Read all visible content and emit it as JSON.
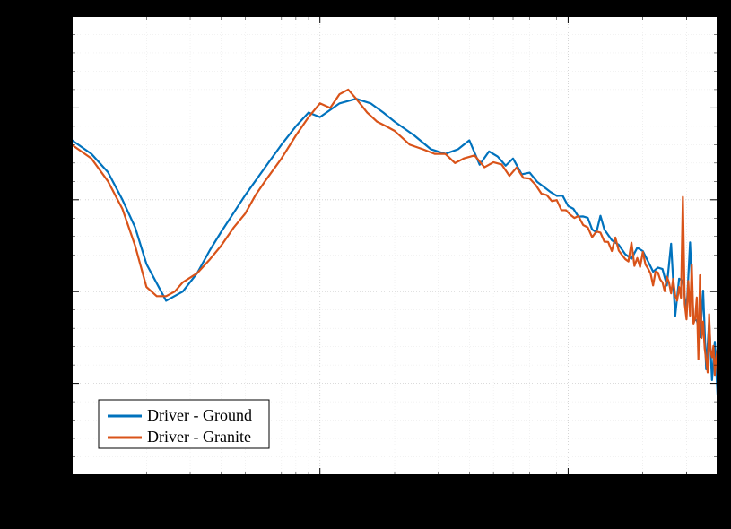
{
  "chart_data": {
    "type": "line",
    "xscale": "log",
    "xlim": [
      10,
      4000
    ],
    "ylim": [
      -20,
      30
    ],
    "x_ticks": [
      10,
      100,
      1000
    ],
    "y_ticks": [
      -20,
      -10,
      0,
      10,
      20,
      30
    ],
    "legend_position": "bottom-left",
    "series": [
      {
        "name": "Driver - Ground",
        "color": "#0072BD",
        "x": [
          10,
          12,
          14,
          16,
          18,
          20,
          24,
          28,
          32,
          36,
          40,
          50,
          60,
          70,
          80,
          90,
          100,
          120,
          140,
          160,
          180,
          200,
          240,
          280,
          320,
          360,
          400,
          440,
          480,
          520,
          560,
          600,
          650,
          700,
          750,
          800,
          850,
          900,
          950,
          1000,
          1050,
          1100,
          1150,
          1200,
          1250,
          1300,
          1350,
          1400,
          1500,
          1600,
          1700,
          1800,
          1900,
          2000,
          2100,
          2200,
          2300,
          2400,
          2500,
          2600,
          2700,
          2800,
          2900,
          3000,
          3100,
          3200,
          3300,
          3400,
          3500,
          3600,
          3700,
          3800,
          3900,
          4000
        ],
        "y": [
          16.5,
          15.0,
          13.0,
          10.0,
          7.0,
          3.0,
          -1.0,
          0.0,
          2.0,
          4.5,
          6.5,
          10.5,
          13.5,
          16.0,
          18.0,
          19.5,
          19.0,
          20.5,
          21.0,
          20.5,
          19.5,
          18.5,
          17.0,
          15.5,
          15.0,
          15.5,
          16.5,
          14.0,
          15.0,
          14.5,
          14.0,
          14.5,
          13.0,
          12.5,
          12.0,
          11.5,
          11.0,
          10.5,
          10.0,
          9.5,
          9.0,
          8.5,
          8.0,
          7.5,
          7.0,
          6.5,
          9.0,
          6.0,
          5.5,
          5.0,
          4.5,
          4.0,
          4.0,
          4.5,
          3.0,
          3.0,
          2.5,
          2.0,
          0.5,
          5.0,
          -1.0,
          0.5,
          1.0,
          -3.0,
          6.0,
          -2.0,
          -4.0,
          -5.0,
          -1.0,
          -7.0,
          -3.0,
          -10.0,
          -6.0,
          -12.0
        ]
      },
      {
        "name": "Driver - Granite",
        "color": "#D95319",
        "x": [
          10,
          12,
          14,
          16,
          18,
          20,
          22,
          24,
          26,
          28,
          32,
          36,
          40,
          45,
          50,
          55,
          60,
          70,
          80,
          90,
          100,
          110,
          120,
          130,
          140,
          155,
          170,
          185,
          200,
          230,
          260,
          290,
          320,
          350,
          380,
          420,
          460,
          500,
          540,
          580,
          620,
          660,
          700,
          740,
          780,
          820,
          860,
          900,
          940,
          980,
          1020,
          1060,
          1100,
          1150,
          1200,
          1250,
          1300,
          1350,
          1400,
          1450,
          1500,
          1550,
          1600,
          1650,
          1700,
          1750,
          1800,
          1850,
          1900,
          1950,
          2000,
          2050,
          2100,
          2150,
          2200,
          2250,
          2300,
          2350,
          2400,
          2450,
          2500,
          2550,
          2600,
          2650,
          2700,
          2750,
          2800,
          2850,
          2900,
          2950,
          3000,
          3050,
          3100,
          3150,
          3200,
          3250,
          3300,
          3350,
          3400,
          3450,
          3500,
          3550,
          3600,
          3650,
          3700,
          3750,
          3800,
          3850,
          3900,
          3950,
          4000
        ],
        "y": [
          16.0,
          14.5,
          12.0,
          9.0,
          5.0,
          0.5,
          -0.5,
          -0.5,
          0.0,
          1.0,
          2.0,
          3.5,
          5.0,
          7.0,
          8.5,
          10.5,
          12.0,
          14.5,
          17.0,
          19.0,
          20.5,
          20.0,
          21.5,
          22.0,
          21.0,
          19.5,
          18.5,
          18.0,
          17.5,
          16.0,
          15.5,
          15.0,
          15.0,
          14.0,
          14.5,
          15.0,
          13.5,
          14.0,
          13.5,
          13.0,
          13.5,
          12.5,
          12.0,
          11.5,
          11.0,
          10.5,
          10.0,
          9.5,
          9.0,
          9.0,
          8.5,
          8.0,
          7.8,
          7.5,
          7.0,
          6.5,
          6.0,
          6.0,
          5.8,
          5.5,
          5.0,
          5.0,
          4.5,
          4.0,
          4.0,
          3.5,
          4.5,
          3.0,
          3.5,
          3.5,
          4.0,
          2.5,
          2.5,
          2.0,
          1.5,
          1.5,
          2.0,
          1.0,
          1.5,
          0.5,
          0.5,
          1.0,
          -1.0,
          3.0,
          -0.5,
          -1.5,
          0.0,
          -1.0,
          12.0,
          -2.0,
          -3.0,
          0.0,
          -2.0,
          4.0,
          -4.0,
          -3.0,
          -2.0,
          -6.0,
          2.0,
          -5.0,
          -4.0,
          -7.0,
          -6.0,
          -9.0,
          -2.0,
          -8.0,
          -7.0,
          -5.0,
          -9.0,
          -7.0,
          -8.0
        ]
      }
    ]
  },
  "legend": {
    "items": [
      {
        "label": "Driver - Ground",
        "color": "#0072BD"
      },
      {
        "label": "Driver - Granite",
        "color": "#D95319"
      }
    ]
  }
}
